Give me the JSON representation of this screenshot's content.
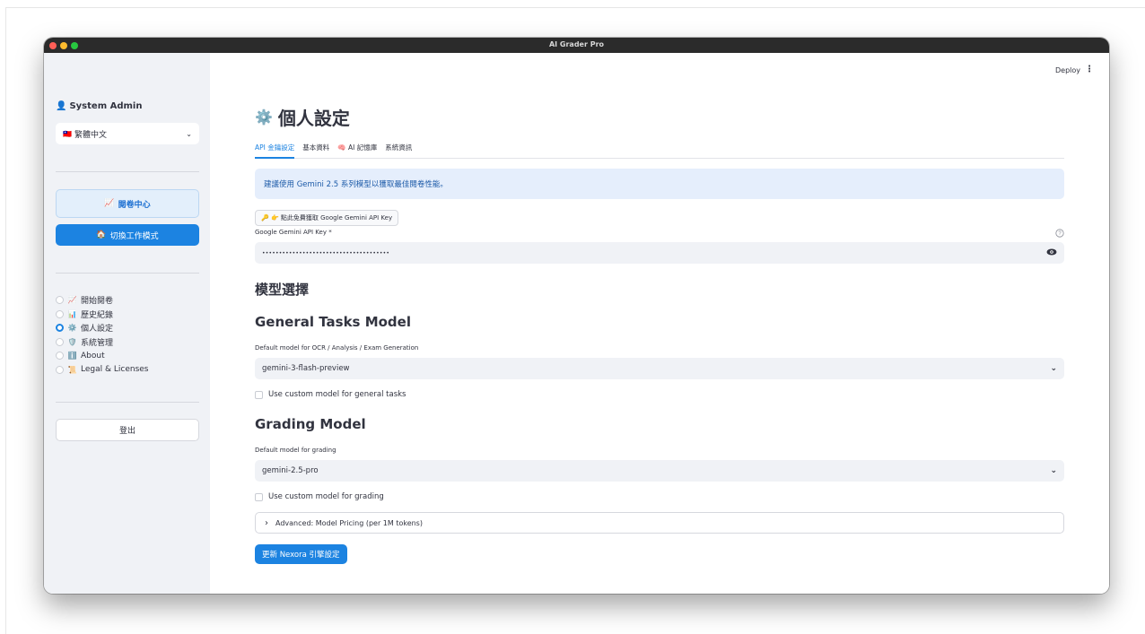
{
  "window": {
    "title": "AI Grader Pro"
  },
  "header": {
    "deploy_label": "Deploy",
    "menu_glyph": "⋮"
  },
  "sidebar": {
    "user_icon": "👤",
    "user_name": "System Admin",
    "language": {
      "flag": "🇹🇼",
      "selected": "繁體中文",
      "chevron": "⌄"
    },
    "grader_center": {
      "icon": "📈",
      "label": "閱卷中心"
    },
    "switch_mode": {
      "icon": "🏠",
      "label": "切換工作模式"
    },
    "nav": [
      {
        "icon": "📈",
        "label": "開始閱卷",
        "selected": false
      },
      {
        "icon": "📊",
        "label": "歷史紀錄",
        "selected": false
      },
      {
        "icon": "⚙️",
        "label": "個人設定",
        "selected": true
      },
      {
        "icon": "🛡️",
        "label": "系統管理",
        "selected": false
      },
      {
        "icon": "ℹ️",
        "label": "About",
        "selected": false
      },
      {
        "icon": "📜",
        "label": "Legal & Licenses",
        "selected": false
      }
    ],
    "logout_label": "登出"
  },
  "main": {
    "title_icon": "⚙️",
    "title": "個人設定",
    "tabs": [
      {
        "label": "API 金鑰設定",
        "active": true
      },
      {
        "label": "基本資料",
        "active": false
      },
      {
        "label": "🧠 AI 記憶庫",
        "active": false
      },
      {
        "label": "系統資訊",
        "active": false
      }
    ],
    "info_text": "建議使用 Gemini 2.5 系列模型以獲取最佳閱卷性能。",
    "get_key_button": "🔑 👉 點此免費獲取 Google Gemini API Key",
    "api_key": {
      "label": "Google Gemini API Key *",
      "value": "••••••••••••••••••••••••••••••••••••••",
      "help_icon": "?",
      "eye_icon": "👁"
    },
    "model_section_title": "模型選擇",
    "general": {
      "title": "General Tasks Model",
      "label": "Default model for OCR / Analysis / Exam Generation",
      "value": "gemini-3-flash-preview",
      "custom_checkbox": "Use custom model for general tasks"
    },
    "grading": {
      "title": "Grading Model",
      "label": "Default model for grading",
      "value": "gemini-2.5-pro",
      "custom_checkbox": "Use custom model for grading"
    },
    "advanced_expander": "Advanced: Model Pricing (per 1M tokens)",
    "update_button": "更新 Nexora 引擎設定",
    "select_chevron": "⌄",
    "expander_chevron": "›"
  },
  "colors": {
    "primary": "#1c83e1",
    "sidebar_bg": "#f0f2f6",
    "info_bg": "#e5eefc"
  }
}
